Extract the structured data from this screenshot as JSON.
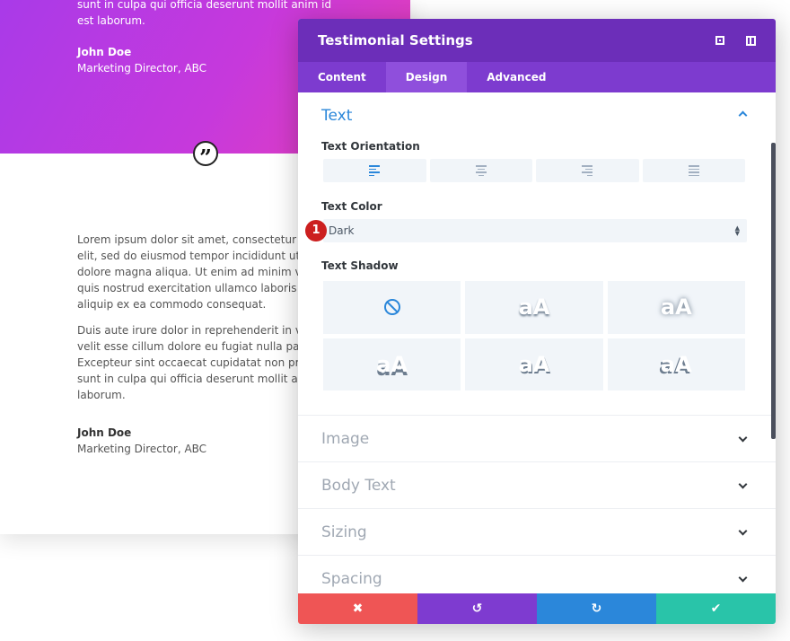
{
  "background": {
    "hero_text": "sunt in culpa qui officia deserunt mollit anim id est laborum.",
    "hero_name": "John Doe",
    "hero_role": "Marketing Director, ABC",
    "quote_glyph": "”",
    "para1_lines": [
      "Lorem ipsum dolor sit amet, consectetur adipiscing",
      "elit, sed do eiusmod tempor incididunt ut labore et",
      "dolore magna aliqua. Ut enim ad minim veniam,",
      "quis nostrud exercitation ullamco laboris nisi ut",
      "aliquip ex ea commodo consequat."
    ],
    "para2_lines": [
      "Duis aute irure dolor in reprehenderit in voluptate",
      "velit esse cillum dolore eu fugiat nulla pariatur.",
      "Excepteur sint occaecat cupidatat non proident,",
      "sunt in culpa qui officia deserunt mollit anim id est",
      "laborum."
    ],
    "name": "John Doe",
    "role": "Marketing Director, ABC"
  },
  "modal": {
    "title": "Testimonial Settings",
    "tabs": [
      {
        "label": "Content"
      },
      {
        "label": "Design"
      },
      {
        "label": "Advanced"
      }
    ],
    "active_tab": "Design",
    "text_section": {
      "title": "Text",
      "orientation_label": "Text Orientation",
      "orientation_options": [
        "left",
        "center",
        "right",
        "justify"
      ],
      "orientation_selected": "left",
      "color_label": "Text Color",
      "color_value": "Dark",
      "step_badge": "1",
      "shadow_label": "Text Shadow",
      "shadow_preview": [
        "aA",
        "aA",
        "aA",
        "aA",
        "aA"
      ]
    },
    "collapsed_sections": [
      {
        "title": "Image"
      },
      {
        "title": "Body Text"
      },
      {
        "title": "Sizing"
      },
      {
        "title": "Spacing"
      }
    ],
    "footer": {
      "cancel_icon": "✖",
      "undo_icon": "↺",
      "redo_icon": "↻",
      "save_icon": "✔"
    }
  },
  "colors": {
    "header": "#6c2eb9",
    "tabs": "#7d3bcf",
    "accent_blue": "#2b87da",
    "cancel": "#ef5555",
    "undo": "#7e3bd0",
    "redo": "#2b87da",
    "save": "#29c4a9"
  }
}
